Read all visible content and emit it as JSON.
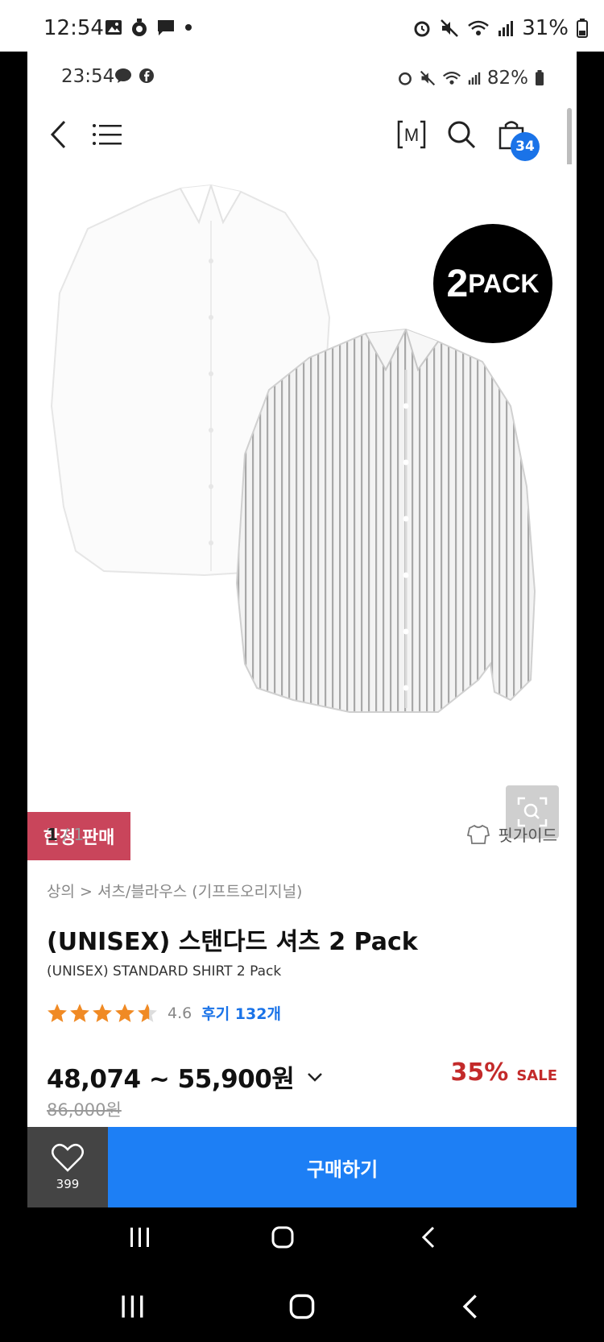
{
  "device_status": {
    "time": "12:54",
    "battery": "31%"
  },
  "inner_status": {
    "time": "23:54",
    "battery": "82%"
  },
  "header": {
    "cart_count": "34",
    "m_label": "M"
  },
  "product_image": {
    "badge_number": "2",
    "badge_text": "PACK",
    "limited_tag": "한정 판매"
  },
  "pager": {
    "current": "1",
    "separator": " / ",
    "total": "1"
  },
  "fit_guide_label": "핏가이드",
  "breadcrumb": "상의 > 셔츠/블라우스 (기프트오리지널)",
  "title_ko": "(UNISEX) 스탠다드 셔츠 2 Pack",
  "title_en": "(UNISEX) STANDARD SHIRT 2 Pack",
  "rating": {
    "score": "4.6",
    "value": 4.6,
    "reviews": "후기 132개",
    "star_color": "#f08a24"
  },
  "price": {
    "range": "48,074 ~ 55,900원",
    "original": "86,000원",
    "discount": "35%",
    "sale_label": "SALE"
  },
  "bottom_bar": {
    "like_count": "399",
    "buy_label": "구매하기",
    "buy_color": "#1d7ff5"
  }
}
